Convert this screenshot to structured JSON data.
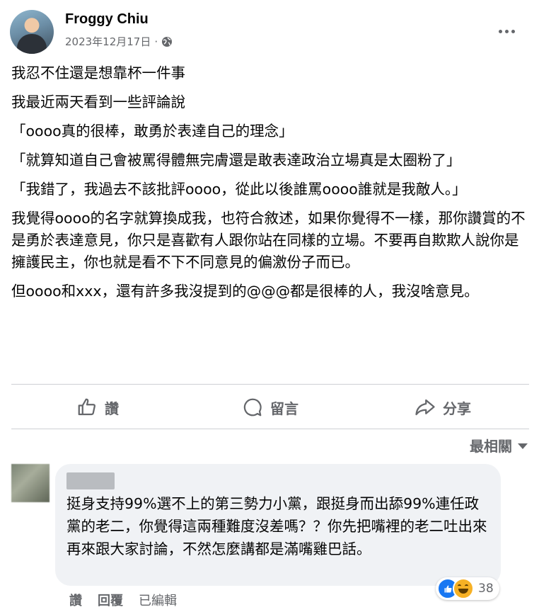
{
  "post": {
    "author": "Froggy Chiu",
    "date": "2023年12月17日",
    "separator": "·",
    "privacy_icon": "globe-icon",
    "more_icon": "more-icon",
    "paragraphs": [
      "我忍不住還是想靠杯一件事",
      "我最近兩天看到一些評論說",
      "「oooo真的很棒，敢勇於表達自己的理念」",
      "「就算知道自己會被罵得體無完膚還是敢表達政治立場真是太圈粉了」",
      "「我錯了，我過去不該批評oooo，從此以後誰罵oooo誰就是我敵人。」",
      "我覺得oooo的名字就算換成我，也符合敘述，如果你覺得不一樣，那你讚賞的不是勇於表達意見，你只是喜歡有人跟你站在同樣的立場。不要再自欺欺人說你是擁護民主，你也就是看不下不同意見的偏激份子而已。",
      "但oooo和xxx，還有許多我沒提到的@@@都是很棒的人，我沒啥意見。"
    ]
  },
  "actions": {
    "like_label": "讚",
    "comment_label": "留言",
    "share_label": "分享"
  },
  "comments_sort": {
    "label": "最相關"
  },
  "comment": {
    "text": "挺身支持99%選不上的第三勢力小黨，跟挺身而出舔99%連任政黨的老二，你覺得這兩種難度沒差嗎？？你先把嘴裡的老二吐出來再來跟大家討論，不然怎麼講都是滿嘴雞巴話。",
    "like_action": "讚",
    "reply_action": "回覆",
    "edited_label": "已編輯",
    "reaction_count": "38",
    "reaction_icons": [
      "like-icon",
      "haha-icon"
    ]
  },
  "colors": {
    "secondary_text": "#65676b",
    "bubble_bg": "#f0f2f5",
    "like_blue": "#1877f2",
    "haha_yellow": "#f7b125"
  }
}
